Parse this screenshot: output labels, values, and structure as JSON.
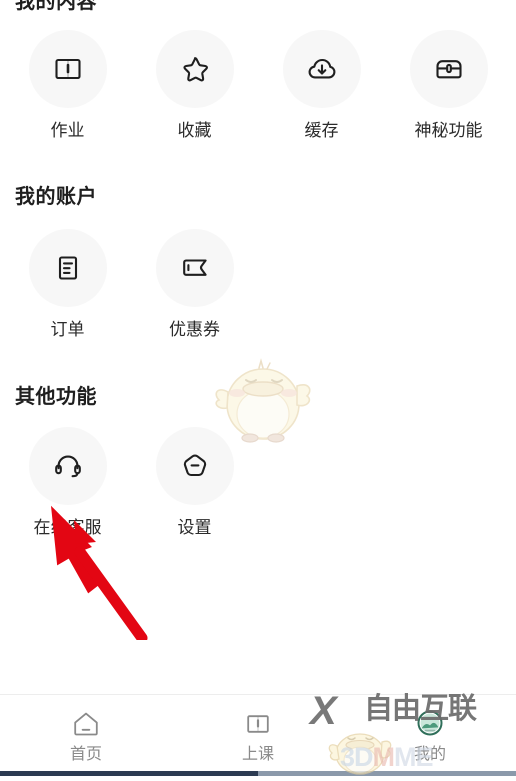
{
  "sections": [
    {
      "id": "content",
      "title": "我的内容",
      "items": [
        {
          "label": "作业",
          "icon": "book-icon"
        },
        {
          "label": "收藏",
          "icon": "star-icon"
        },
        {
          "label": "缓存",
          "icon": "cloud-download-icon"
        },
        {
          "label": "神秘功能",
          "icon": "treasure-chest-icon"
        }
      ]
    },
    {
      "id": "account",
      "title": "我的账户",
      "items": [
        {
          "label": "订单",
          "icon": "document-list-icon"
        },
        {
          "label": "优惠券",
          "icon": "coupon-ticket-icon"
        }
      ]
    },
    {
      "id": "other",
      "title": "其他功能",
      "items": [
        {
          "label": "在线客服",
          "icon": "headset-icon"
        },
        {
          "label": "设置",
          "icon": "hexagon-minus-icon"
        }
      ]
    }
  ],
  "tabbar": {
    "tabs": [
      {
        "label": "首页",
        "icon": "home-icon",
        "active": false
      },
      {
        "label": "上课",
        "icon": "open-book-icon",
        "active": false
      },
      {
        "label": "我的",
        "icon": "profile-circle-icon",
        "active": true
      }
    ]
  },
  "annotation": {
    "arrow_color": "#e30613",
    "points_to": "在线客服"
  },
  "watermarks": {
    "ziyou_x": "X",
    "ziyou_text": "自由互联",
    "threedm_1": "3D",
    "threedm_2": "M",
    "threedm_3": "ME",
    "mascot": "duck-mascot"
  },
  "colors": {
    "icon_bg": "#f7f7f7",
    "icon_stroke": "#1f1f1f",
    "title": "#1f1f1f",
    "label": "#2b2b2b",
    "tab_inactive": "#8a8a8a",
    "tab_active_accent": "#2fae7f",
    "accent_red": "#e30613",
    "divider": "#ededed"
  }
}
